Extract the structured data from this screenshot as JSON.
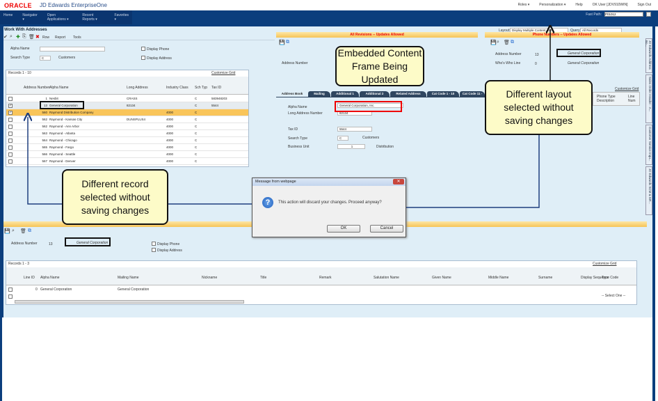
{
  "header": {
    "logo": "ORACLE",
    "product": "JD Edwards EnterpriseOne",
    "links": [
      "Roles ▾",
      "Personalization ▾",
      "Help",
      "OK User [JDV910WIN]",
      "Sign Out"
    ]
  },
  "nav": {
    "items": [
      "Home",
      "Navigator ▾",
      "Open Applications ▾",
      "Recent Reports ▾",
      "Favorites ▾"
    ],
    "fast_path_label": "Fast Path:",
    "fast_path_value": "P01012"
  },
  "form": {
    "title": "Work With Addresses",
    "toolbar": [
      "Row",
      "Report",
      "Tools"
    ],
    "alpha_name_label": "Alpha Name",
    "alpha_name_value": "",
    "search_type_label": "Search Type",
    "search_type_value": "C",
    "search_type_desc": "Customers",
    "display_phone": "Display Phone",
    "display_address": "Display Address"
  },
  "grid": {
    "records": "Records 1 - 10",
    "customize": "Customize Grid",
    "columns": [
      "Address Number",
      "Alpha Name",
      "Long Address",
      "Industry Class",
      "Sch Typ",
      "Tax ID"
    ],
    "rows": [
      [
        "1",
        "Nesbit",
        "CRASS",
        "",
        "C",
        "583948203"
      ],
      [
        "13",
        "General Corporation",
        "82134",
        "",
        "C",
        "5544"
      ],
      [
        "560",
        "Raymond  Distribution Company",
        "",
        "4000",
        "C",
        ""
      ],
      [
        "562",
        "Raymond - Kansas City",
        "DUNSPLUS4",
        "4000",
        "C",
        ""
      ],
      [
        "562",
        "Raymond - Ann Arbor",
        "",
        "4000",
        "C",
        ""
      ],
      [
        "563",
        "Raymond - Atlanta",
        "",
        "4000",
        "C",
        ""
      ],
      [
        "564",
        "Raymond - Chicago",
        "",
        "4000",
        "C",
        ""
      ],
      [
        "565",
        "Raymond - Fargo",
        "",
        "4000",
        "C",
        ""
      ],
      [
        "566",
        "Raymond - Seattle",
        "",
        "4000",
        "C",
        ""
      ],
      [
        "567",
        "Raymond - Denver",
        "",
        "4000",
        "C",
        ""
      ]
    ]
  },
  "layout": {
    "layout_label": "Layout:",
    "layout_value": "Display Multiple Content_SO",
    "query_label": "Query:",
    "query_value": "All Records"
  },
  "revisions": {
    "title": "All Revisions -- Updates Allowed",
    "address_number_label": "Address Number",
    "tabs": [
      "Address Book",
      "Mailing",
      "Additional 1",
      "Additional 2",
      "Related Address",
      "Cat Code 1 - 10",
      "Cat Code 11 -"
    ],
    "alpha_name_label": "Alpha Name",
    "alpha_name_value": "General Corporation, Inc.",
    "long_address_label": "Long Address Number",
    "long_address_value": "82134",
    "tax_id_label": "Tax ID",
    "tax_id_value": "5544",
    "search_type_label": "Search Type",
    "search_type_value": "C",
    "search_type_desc": "Customers",
    "business_unit_label": "Business Unit",
    "business_unit_value": "1",
    "business_unit_desc": "Distribution"
  },
  "phone": {
    "title": "Phone Numbers -- Updates Allowed",
    "address_number_label": "Address Number",
    "address_number_value": "13",
    "address_name": "General Corporation",
    "whos_who_label": "Who's Who Line",
    "whos_who_value": "0",
    "whos_who_name": "General Corporation",
    "customize": "Customize Grid",
    "columns": [
      "Phone Type Description",
      "Line Num"
    ]
  },
  "vertical_tabs": [
    "JD Edwards Address Bo...",
    "Sales Order Header - A...",
    "Customer Service Inqu...",
    "JD Edwards SCM & MF..."
  ],
  "bottom": {
    "address_number_label": "Address Number",
    "address_number_value": "13",
    "address_name": "General Corporation",
    "display_phone": "Display Phone",
    "display_address": "Display Address",
    "records": "Records 1 - 3",
    "customize": "Customize Grid",
    "columns": [
      "Line ID",
      "Alpha Name",
      "Mailing Name",
      "Nickname",
      "Title",
      "Remark",
      "Salutation Name",
      "Given Name",
      "Middle Name",
      "Surname",
      "Display Sequence",
      "Type Code"
    ],
    "row": {
      "line_id": "0",
      "alpha_name": "General Corporation",
      "mailing_name": "General Corporation",
      "type_code": "-- Select One --"
    }
  },
  "dialog": {
    "title": "Message from webpage",
    "message": "This action will discard your changes. Proceed anyway?",
    "ok": "OK",
    "cancel": "Cancel"
  },
  "callouts": {
    "embedded": "Embedded Content Frame Being Updated",
    "layout": "Different layout selected without saving changes",
    "record": "Different record selected without saving changes"
  },
  "colors": {
    "nav": "#0b3e7d",
    "panel": "#dfeef7",
    "header_gradient": "#f6c456",
    "callout": "#fdfbc8",
    "arrow": "#1f3f7f",
    "highlight_row": "#f9c55a",
    "red_box": "#e00000"
  }
}
